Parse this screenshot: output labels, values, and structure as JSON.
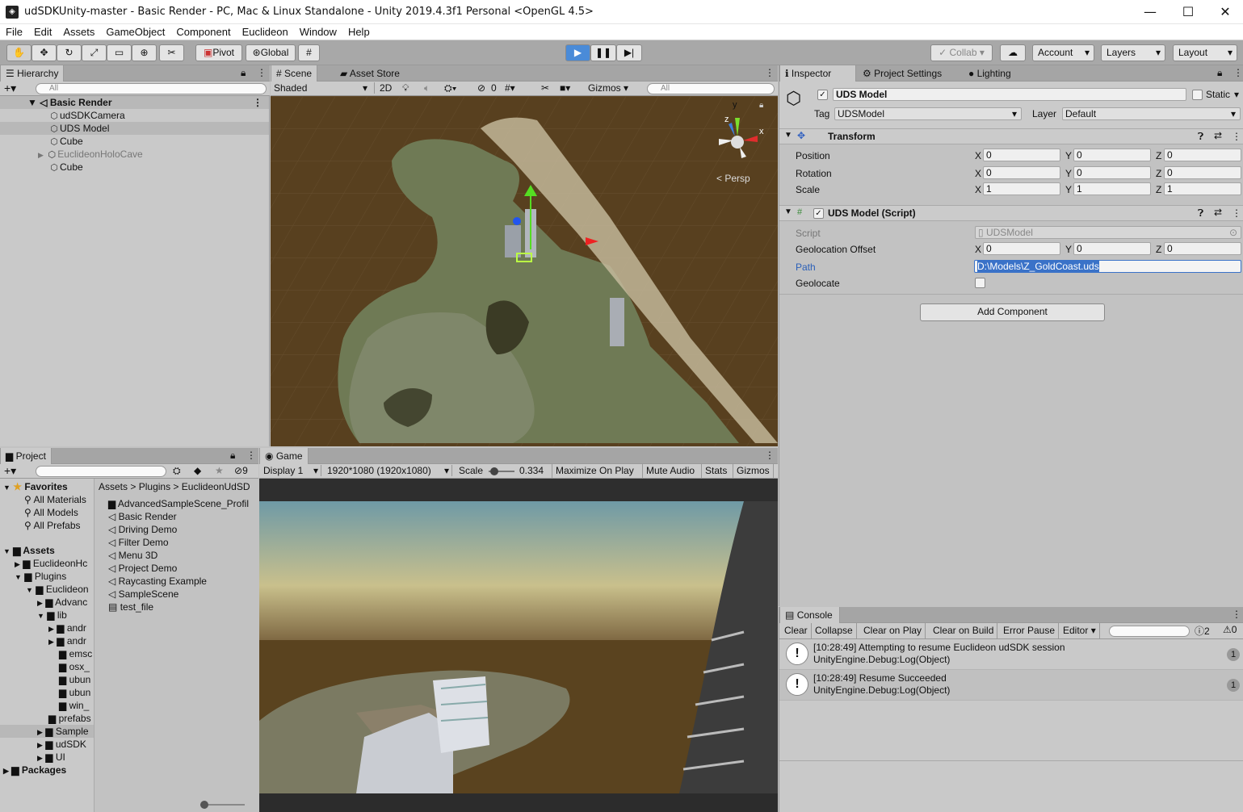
{
  "window": {
    "title": "udSDKUnity-master - Basic Render - PC, Mac & Linux Standalone - Unity 2019.4.3f1 Personal <OpenGL 4.5>",
    "minimize": "—",
    "maximize": "☐",
    "close": "✕"
  },
  "menu": [
    "File",
    "Edit",
    "Assets",
    "GameObject",
    "Component",
    "Euclideon",
    "Window",
    "Help"
  ],
  "toolbar": {
    "pivot": "Pivot",
    "global": "Global",
    "collab": "Collab",
    "account": "Account",
    "layers": "Layers",
    "layout": "Layout"
  },
  "hierarchy": {
    "tab": "Hierarchy",
    "search": "All",
    "scene": "Basic Render",
    "items": [
      "udSDKCamera",
      "UDS Model",
      "Cube",
      "EuclideonHoloCave",
      "Cube"
    ]
  },
  "scene": {
    "tab_scene": "Scene",
    "tab_store": "Asset Store",
    "shading": "Shaded",
    "mode2d": "2D",
    "hidden_count": "0",
    "gizmos": "Gizmos",
    "search": "All",
    "persp": "Persp",
    "axis_x": "x",
    "axis_y": "y",
    "axis_z": "z"
  },
  "inspector": {
    "tab": "Inspector",
    "tab_project_settings": "Project Settings",
    "tab_lighting": "Lighting",
    "object_name": "UDS Model",
    "static": "Static",
    "tag_label": "Tag",
    "tag": "UDSModel",
    "layer_label": "Layer",
    "layer": "Default",
    "transform": {
      "title": "Transform",
      "rows": [
        {
          "label": "Position",
          "x": "0",
          "y": "0",
          "z": "0"
        },
        {
          "label": "Rotation",
          "x": "0",
          "y": "0",
          "z": "0"
        },
        {
          "label": "Scale",
          "x": "1",
          "y": "1",
          "z": "1"
        }
      ]
    },
    "script_comp": {
      "title": "UDS Model (Script)",
      "script_label": "Script",
      "script_value": "UDSModel",
      "geo_label": "Geolocation Offset",
      "gx": "0",
      "gy": "0",
      "gz": "0",
      "path_label": "Path",
      "path_value": "D:\\Models\\Z_GoldCoast.uds",
      "geolocate_label": "Geolocate"
    },
    "add_component": "Add Component",
    "axis_x": "X",
    "axis_y": "Y",
    "axis_z": "Z"
  },
  "project": {
    "tab": "Project",
    "hidden_count": "9",
    "favorites": "Favorites",
    "fav_items": [
      "All Materials",
      "All Models",
      "All Prefabs"
    ],
    "assets": "Assets",
    "tree": [
      "EuclideonHc",
      "Plugins",
      "Euclideon",
      "Advanc",
      "lib",
      "andr",
      "andr",
      "emsc",
      "osx_",
      "ubun",
      "ubun",
      "win_",
      "prefabs",
      "Sample",
      "udSDK",
      "UI"
    ],
    "packages": "Packages",
    "breadcrumb": [
      "Assets",
      "Plugins",
      "EuclideonUdSD"
    ],
    "files": [
      "AdvancedSampleScene_Profil",
      "Basic Render",
      "Driving Demo",
      "Filter Demo",
      "Menu 3D",
      "Project Demo",
      "Raycasting Example",
      "SampleScene",
      "test_file"
    ]
  },
  "game": {
    "tab": "Game",
    "display": "Display 1",
    "resolution": "1920*1080 (1920x1080)",
    "scale_label": "Scale",
    "scale_value": "0.334",
    "maximize": "Maximize On Play",
    "mute": "Mute Audio",
    "stats": "Stats",
    "gizmos": "Gizmos"
  },
  "console": {
    "tab": "Console",
    "buttons": [
      "Clear",
      "Collapse",
      "Clear on Play",
      "Clear on Build",
      "Error Pause",
      "Editor"
    ],
    "warn_count": "2",
    "err_count": "0",
    "logs": [
      {
        "line1": "[10:28:49] Attempting to resume Euclideon udSDK session",
        "line2": "UnityEngine.Debug:Log(Object)",
        "count": "1"
      },
      {
        "line1": "[10:28:49] Resume Succeeded",
        "line2": "UnityEngine.Debug:Log(Object)",
        "count": "1"
      }
    ]
  }
}
